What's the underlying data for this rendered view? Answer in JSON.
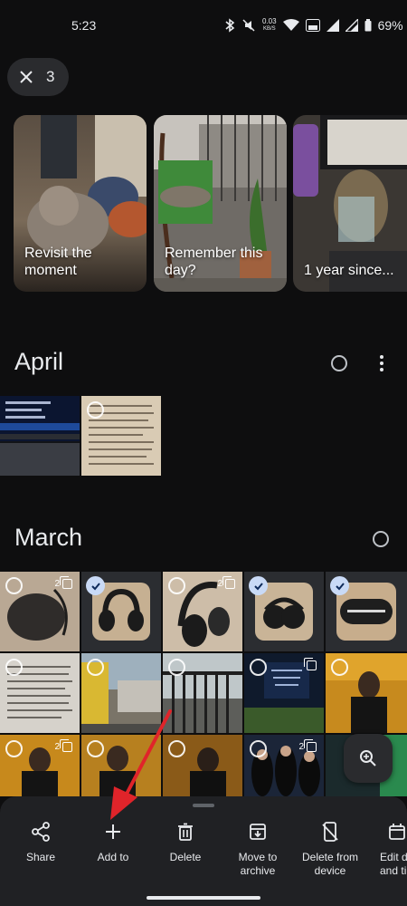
{
  "status_bar": {
    "time": "5:23",
    "speed_value": "0.03",
    "speed_unit": "KB/S",
    "battery": "69%"
  },
  "selection": {
    "count": "3"
  },
  "memories": [
    {
      "label": "Revisit the moment"
    },
    {
      "label": "Remember this day?"
    },
    {
      "label": "1 year since..."
    }
  ],
  "sections": [
    {
      "title": "April"
    },
    {
      "title": "March"
    }
  ],
  "stack_badges": {
    "a": "2",
    "b": "2",
    "c": "2",
    "d": "2"
  },
  "actions": [
    {
      "label": "Share",
      "icon": "share-icon"
    },
    {
      "label": "Add to",
      "icon": "plus-icon"
    },
    {
      "label": "Delete",
      "icon": "trash-icon"
    },
    {
      "label": "Move to archive",
      "icon": "archive-icon"
    },
    {
      "label": "Delete from device",
      "icon": "delete-device-icon"
    },
    {
      "label": "Edit d and ti",
      "icon": "calendar-edit-icon"
    }
  ],
  "colors": {
    "background": "#0e0e0f",
    "sheet": "#202124",
    "accent_arrow": "#e0242a",
    "check": "#c9daf6"
  }
}
